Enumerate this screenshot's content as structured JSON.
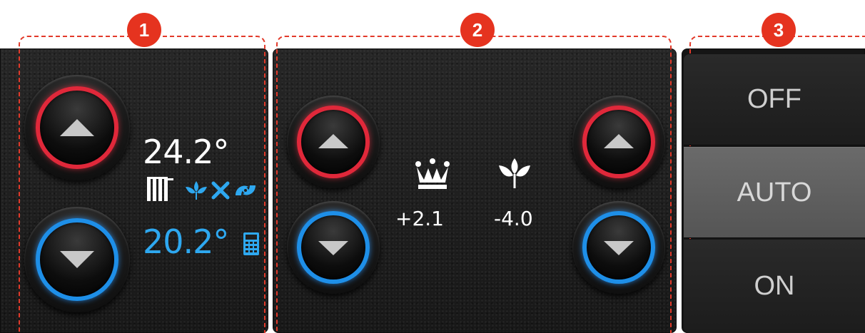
{
  "badges": [
    "1",
    "2",
    "3"
  ],
  "zone1": {
    "current_temp": "24.2°",
    "setpoint_temp": "20.2°",
    "icons": [
      "radiator-icon",
      "leaf-icon",
      "x-icon",
      "fan-icon",
      "calculator-icon"
    ]
  },
  "zone2": {
    "comfort_icon": "crown-icon",
    "comfort_offset": "+2.1",
    "eco_icon": "leaf-icon",
    "eco_offset": "-4.0"
  },
  "mode": {
    "off_label": "OFF",
    "auto_label": "AUTO",
    "on_label": "ON",
    "selected": "AUTO"
  },
  "colors": {
    "accent_red": "#e0283a",
    "accent_blue": "#1e8fe8",
    "temp_blue": "#2ea8f0",
    "badge": "#e5331f"
  }
}
